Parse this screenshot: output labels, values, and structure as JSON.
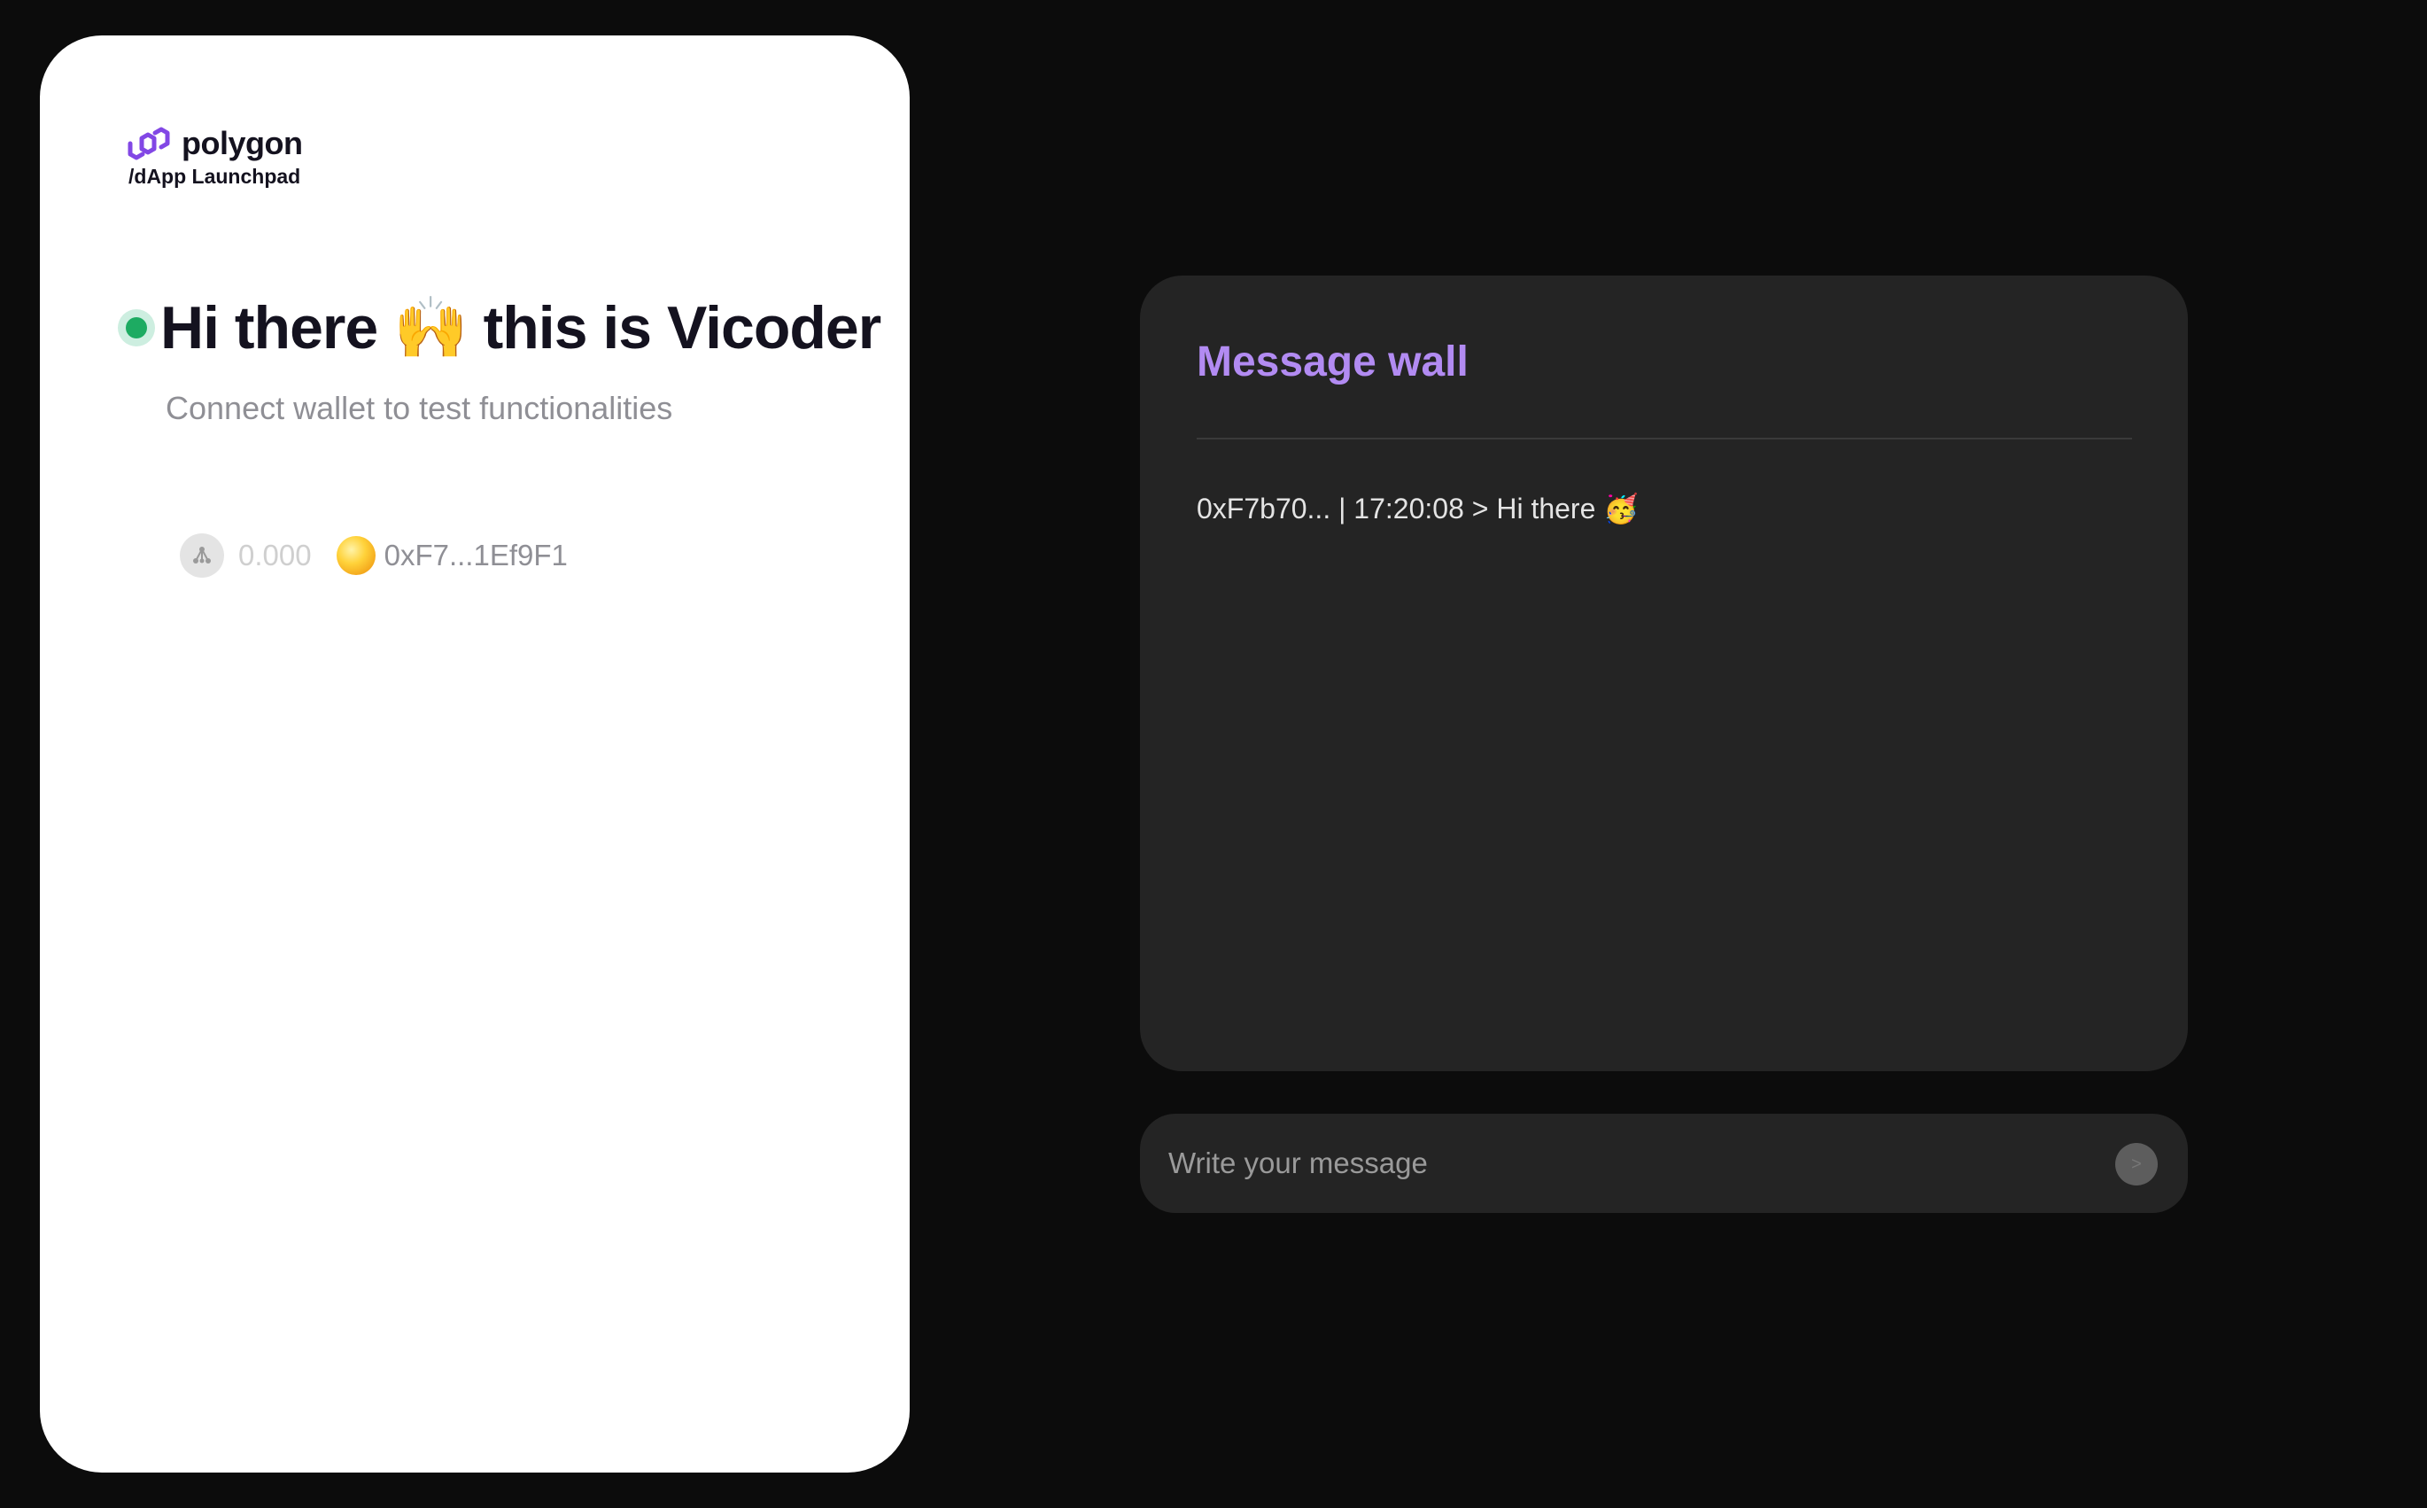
{
  "brand": {
    "name": "polygon",
    "subtitle": "/dApp Launchpad",
    "logo_icon": "polygon-logo-icon",
    "accent": "#8247e5"
  },
  "hero": {
    "greeting": "Hi there 🙌 this is Vicoder",
    "subtitle": "Connect wallet to test functionalities",
    "status_color": "#1dab62"
  },
  "wallet": {
    "network_icon": "network-icon",
    "balance": "0.000",
    "address": "0xF7...1Ef9F1"
  },
  "message_wall": {
    "title": "Message wall",
    "title_color": "#b28bf2",
    "messages": [
      {
        "text": "0xF7b70... | 17:20:08 > Hi there 🥳"
      }
    ]
  },
  "composer": {
    "placeholder": "Write your message",
    "value": "",
    "send_icon": ">"
  }
}
